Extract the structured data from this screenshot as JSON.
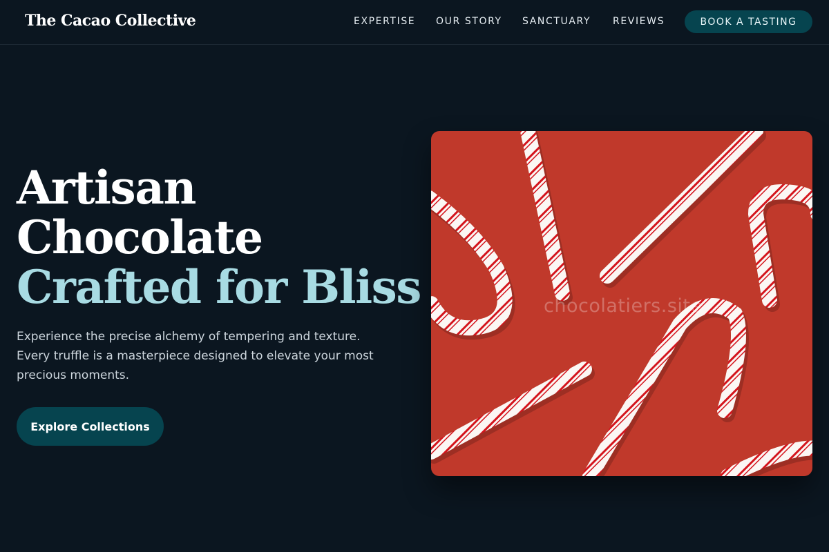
{
  "brand": {
    "name": "The Cacao Collective"
  },
  "nav": {
    "links": [
      "EXPERTISE",
      "OUR STORY",
      "SANCTUARY",
      "REVIEWS"
    ],
    "cta": "BOOK A TASTING"
  },
  "hero": {
    "title_line1": "Artisan",
    "title_line2": "Chocolate",
    "title_accent": "Crafted for Bliss",
    "description_lines": [
      "Experience the precise alchemy of tempering and texture.",
      "Every truffle is a masterpiece designed to elevate your most",
      "precious moments."
    ],
    "button": "Explore Collections",
    "image_watermark": "chocolatiers.site"
  },
  "colors": {
    "background": "#0b1620",
    "accent_text": "#a8dbe3",
    "button_bg": "#06444f",
    "image_bg": "#c0392b",
    "candy_red": "#d4141c"
  }
}
